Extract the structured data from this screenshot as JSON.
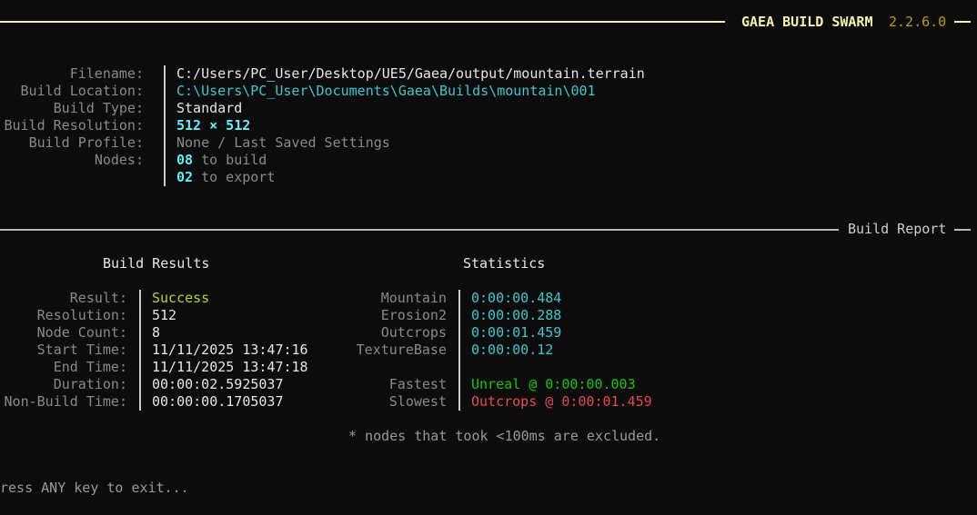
{
  "header": {
    "title": "GAEA BUILD SWARM",
    "version": "2.2.6.0",
    "title_color": "#f9f1a5",
    "version_color": "#c19c00"
  },
  "info": {
    "labels": [
      "Filename:",
      "Build Location:",
      "Build Type:",
      "Build Resolution:",
      "Build Profile:",
      "Nodes:"
    ],
    "filename": "C:/Users/PC_User/Desktop/UE5/Gaea/output/mountain.terrain",
    "build_location": "C:\\Users\\PC_User\\Documents\\Gaea\\Builds\\mountain\\001",
    "build_type": "Standard",
    "build_resolution": "512 × 512",
    "build_profile": "None / Last Saved Settings",
    "nodes_build_count": "08",
    "nodes_build_text": " to build",
    "nodes_export_count": "02",
    "nodes_export_text": " to export"
  },
  "report": {
    "section_label": "Build Report",
    "results_title": "Build Results",
    "statistics_title": "Statistics",
    "result_labels": [
      "Result:",
      "Resolution:",
      "Node Count:",
      "Start Time:",
      "End Time:",
      "Duration:",
      "Non-Build Time:"
    ],
    "result_values": [
      "Success",
      "512",
      "8",
      "11/11/2025 13:47:16",
      "11/11/2025 13:47:18",
      "00:00:02.5925037",
      "00:00:00.1705037"
    ],
    "stat_nodes": [
      "Mountain",
      "Erosion2",
      "Outcrops",
      "TextureBase"
    ],
    "stat_times": [
      "0:00:00.484",
      "0:00:00.288",
      "0:00:01.459",
      "0:00:00.12"
    ],
    "fastest_label": "Fastest",
    "fastest_value": "Unreal @ 0:00:00.003",
    "slowest_label": "Slowest",
    "slowest_value": "Outcrops @ 0:00:01.459",
    "footnote": "* nodes that took <100ms are excluded."
  },
  "prompt": {
    "text": "ress ANY key to exit..."
  }
}
